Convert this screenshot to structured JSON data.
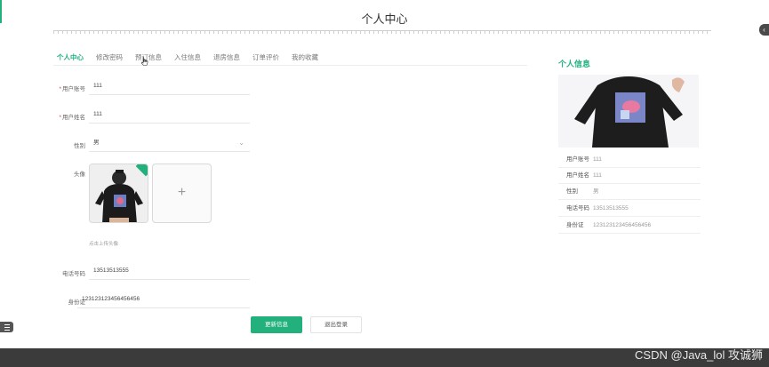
{
  "page": {
    "title": "个人中心"
  },
  "tabs": [
    "个人中心",
    "修改密码",
    "预订信息",
    "入住信息",
    "退房信息",
    "订单评价",
    "我的收藏"
  ],
  "form": {
    "username": {
      "label": "用户账号",
      "value": "111",
      "required": true
    },
    "realname": {
      "label": "用户姓名",
      "value": "111",
      "required": true
    },
    "gender": {
      "label": "性别",
      "value": "男"
    },
    "avatar": {
      "label": "头像",
      "hint": "点击上传头像"
    },
    "phone": {
      "label": "电话号码",
      "value": "13513513555"
    },
    "idcard": {
      "label": "身份证",
      "value": "123123123456456456"
    }
  },
  "buttons": {
    "update": "更新信息",
    "logout": "退出登录"
  },
  "sidebar": {
    "title": "个人信息",
    "rows": [
      {
        "key": "用户账号",
        "value": "111"
      },
      {
        "key": "用户姓名",
        "value": "111"
      },
      {
        "key": "性别",
        "value": "男"
      },
      {
        "key": "电话号码",
        "value": "13513513555"
      },
      {
        "key": "身份证",
        "value": "123123123456456456"
      }
    ]
  },
  "watermark": "CSDN @Java_lol 攻诚狮",
  "colors": {
    "accent": "#22b07d",
    "footer": "#3b3b3b"
  }
}
